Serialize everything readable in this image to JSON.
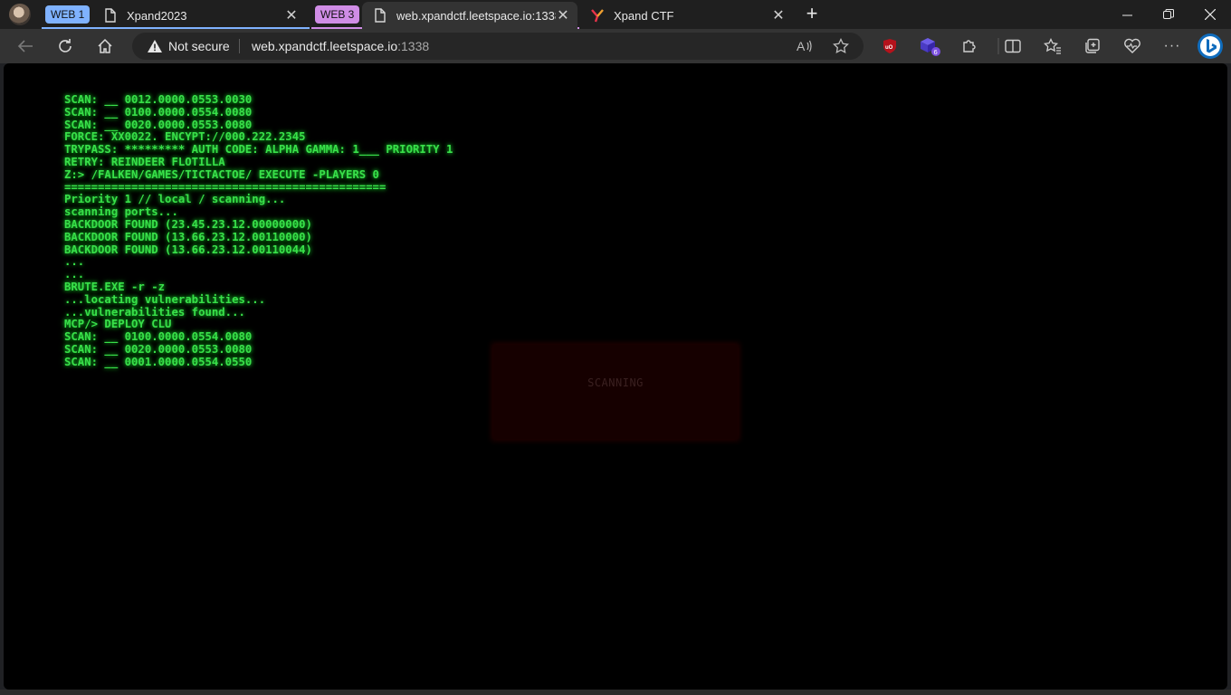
{
  "browser": {
    "groups": [
      {
        "label": "WEB 1",
        "color": "#7fb2ff"
      },
      {
        "label": "WEB 3",
        "color": "#d08de6"
      }
    ],
    "tabs": [
      {
        "title": "Xpand2023"
      },
      {
        "title": "web.xpandctf.leetspace.io:1338"
      },
      {
        "title": "Xpand CTF"
      }
    ],
    "address_bar": {
      "security_label": "Not secure",
      "url_host": "web.xpandctf.leetspace.io",
      "url_port": ":1338"
    },
    "extensions": {
      "badge_count": "6"
    }
  },
  "page": {
    "terminal_lines": [
      "SCAN: __ 0012.0000.0553.0030",
      "SCAN: __ 0100.0000.0554.0080",
      "SCAN: __ 0020.0000.0553.0080",
      "FORCE: XX0022. ENCYPT://000.222.2345",
      "TRYPASS: ********* AUTH CODE: ALPHA GAMMA: 1___ PRIORITY 1",
      "RETRY: REINDEER FLOTILLA",
      "Z:> /FALKEN/GAMES/TICTACTOE/ EXECUTE -PLAYERS 0",
      "================================================",
      "Priority 1 // local / scanning...",
      "scanning ports...",
      "BACKDOOR FOUND (23.45.23.12.00000000)",
      "BACKDOOR FOUND (13.66.23.12.00110000)",
      "BACKDOOR FOUND (13.66.23.12.00110044)",
      "...",
      "...",
      "BRUTE.EXE -r -z",
      "...locating vulnerabilities...",
      "...vulnerabilities found...",
      "MCP/> DEPLOY CLU",
      "SCAN: __ 0100.0000.0554.0080",
      "SCAN: __ 0020.0000.0553.0080",
      "SCAN: __ 0001.0000.0554.0550"
    ],
    "scan_overlay_label": "SCANNING",
    "colors": {
      "terminal_green": "#39e04a",
      "overlay_bg": "#160000"
    }
  }
}
